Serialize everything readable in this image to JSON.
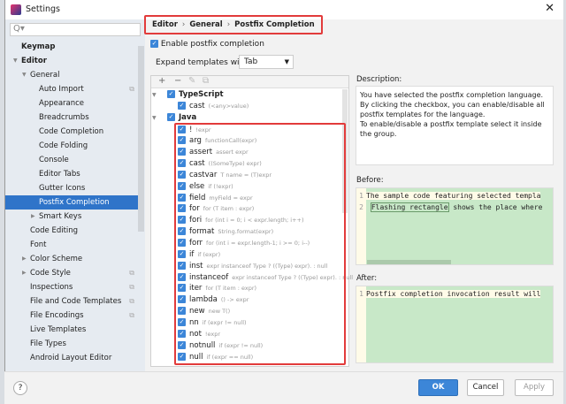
{
  "window": {
    "title": "Settings",
    "close": "✕"
  },
  "search": {
    "placeholder": "Q▾"
  },
  "sidebar": {
    "items": [
      {
        "label": "Keymap",
        "level": 0,
        "bold": true
      },
      {
        "label": "Editor",
        "level": 0,
        "bold": true,
        "expanded": true
      },
      {
        "label": "General",
        "level": 1,
        "expanded": true
      },
      {
        "label": "Auto Import",
        "level": 2,
        "copy": true
      },
      {
        "label": "Appearance",
        "level": 2
      },
      {
        "label": "Breadcrumbs",
        "level": 2
      },
      {
        "label": "Code Completion",
        "level": 2
      },
      {
        "label": "Code Folding",
        "level": 2
      },
      {
        "label": "Console",
        "level": 2
      },
      {
        "label": "Editor Tabs",
        "level": 2
      },
      {
        "label": "Gutter Icons",
        "level": 2
      },
      {
        "label": "Postfix Completion",
        "level": 2,
        "selected": true
      },
      {
        "label": "Smart Keys",
        "level": 2,
        "collapsed": true
      },
      {
        "label": "Code Editing",
        "level": 1
      },
      {
        "label": "Font",
        "level": 1
      },
      {
        "label": "Color Scheme",
        "level": 1,
        "collapsed": true
      },
      {
        "label": "Code Style",
        "level": 1,
        "collapsed": true,
        "copy": true
      },
      {
        "label": "Inspections",
        "level": 1,
        "copy": true
      },
      {
        "label": "File and Code Templates",
        "level": 1,
        "copy": true
      },
      {
        "label": "File Encodings",
        "level": 1,
        "copy": true
      },
      {
        "label": "Live Templates",
        "level": 1
      },
      {
        "label": "File Types",
        "level": 1
      },
      {
        "label": "Android Layout Editor",
        "level": 1
      }
    ]
  },
  "breadcrumb": [
    "Editor",
    "General",
    "Postfix Completion"
  ],
  "enable": {
    "label": "Enable postfix completion",
    "checked": true
  },
  "expand": {
    "label": "Expand templates with",
    "value": "Tab"
  },
  "toolbar": {
    "add": "+",
    "remove": "−",
    "edit": "✎",
    "copy": "⧉"
  },
  "tree": {
    "typescript": {
      "label": "TypeScript",
      "items": [
        {
          "key": "cast",
          "hint": "(<any>value)"
        }
      ]
    },
    "java": {
      "label": "Java",
      "items": [
        {
          "key": "!",
          "hint": "!expr"
        },
        {
          "key": "arg",
          "hint": "functionCall(expr)"
        },
        {
          "key": "assert",
          "hint": "assert expr"
        },
        {
          "key": "cast",
          "hint": "((SomeType) expr)"
        },
        {
          "key": "castvar",
          "hint": "T name = (T)expr"
        },
        {
          "key": "else",
          "hint": "if (!expr)"
        },
        {
          "key": "field",
          "hint": "myField = expr"
        },
        {
          "key": "for",
          "hint": "for (T item : expr)"
        },
        {
          "key": "fori",
          "hint": "for (int i = 0; i < expr.length; i++)"
        },
        {
          "key": "format",
          "hint": "String.format(expr)"
        },
        {
          "key": "forr",
          "hint": "for (int i = expr.length-1; i >= 0; i--)"
        },
        {
          "key": "if",
          "hint": "if (expr)"
        },
        {
          "key": "inst",
          "hint": "expr instanceof Type ? ((Type) expr). : null"
        },
        {
          "key": "instanceof",
          "hint": "expr instanceof Type ? ((Type) expr). : null"
        },
        {
          "key": "iter",
          "hint": "for (T item : expr)"
        },
        {
          "key": "lambda",
          "hint": "() -> expr"
        },
        {
          "key": "new",
          "hint": "new T()"
        },
        {
          "key": "nn",
          "hint": "if (expr != null)"
        },
        {
          "key": "not",
          "hint": "!expr"
        },
        {
          "key": "notnull",
          "hint": "if (expr != null)"
        },
        {
          "key": "null",
          "hint": "if (expr == null)"
        }
      ]
    }
  },
  "description": {
    "label": "Description:",
    "text": "You have selected the postfix completion language.\nBy clicking the checkbox, you can enable/disable all postfix templates for the language.\nTo enable/disable a postfix template select it inside the group."
  },
  "before": {
    "label": "Before:",
    "lines": [
      {
        "n": "1",
        "pre": "The sample code featuring selected templa",
        "flash": "",
        "post": ""
      },
      {
        "n": "2",
        "pre": "",
        "flash": "Flashing rectangle",
        "post": " shows the place where"
      }
    ]
  },
  "after": {
    "label": "After:",
    "lines": [
      {
        "n": "1",
        "text": "Postfix completion invocation result will"
      }
    ]
  },
  "buttons": {
    "help": "?",
    "ok": "OK",
    "cancel": "Cancel",
    "apply": "Apply"
  }
}
